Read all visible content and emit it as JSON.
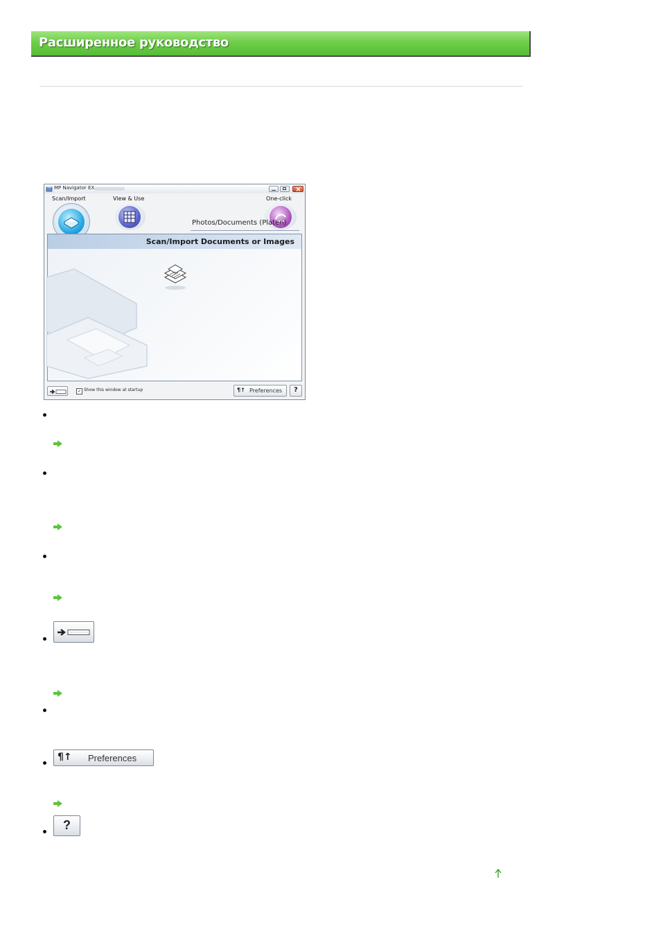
{
  "header": {
    "title": "Расширенное руководство"
  },
  "app": {
    "window_title": "MP Navigator EX",
    "tabs": [
      {
        "label": "Scan/Import"
      },
      {
        "label": "View & Use"
      },
      {
        "label": "One-click"
      }
    ],
    "panel_title": "Scan/Import Documents or Images",
    "item_label": "Photos/Documents (Platen)",
    "startup_checkbox_label": "Show this window at startup",
    "startup_checked": true,
    "preferences_label": "Preferences",
    "help_label": "?"
  },
  "buttons": {
    "preferences_label": "Preferences",
    "help_label": "?"
  },
  "colors": {
    "header_green": "#6fce4a",
    "link_arrow_green": "#5cc43a",
    "top_arrow_green": "#2f9a2a"
  }
}
